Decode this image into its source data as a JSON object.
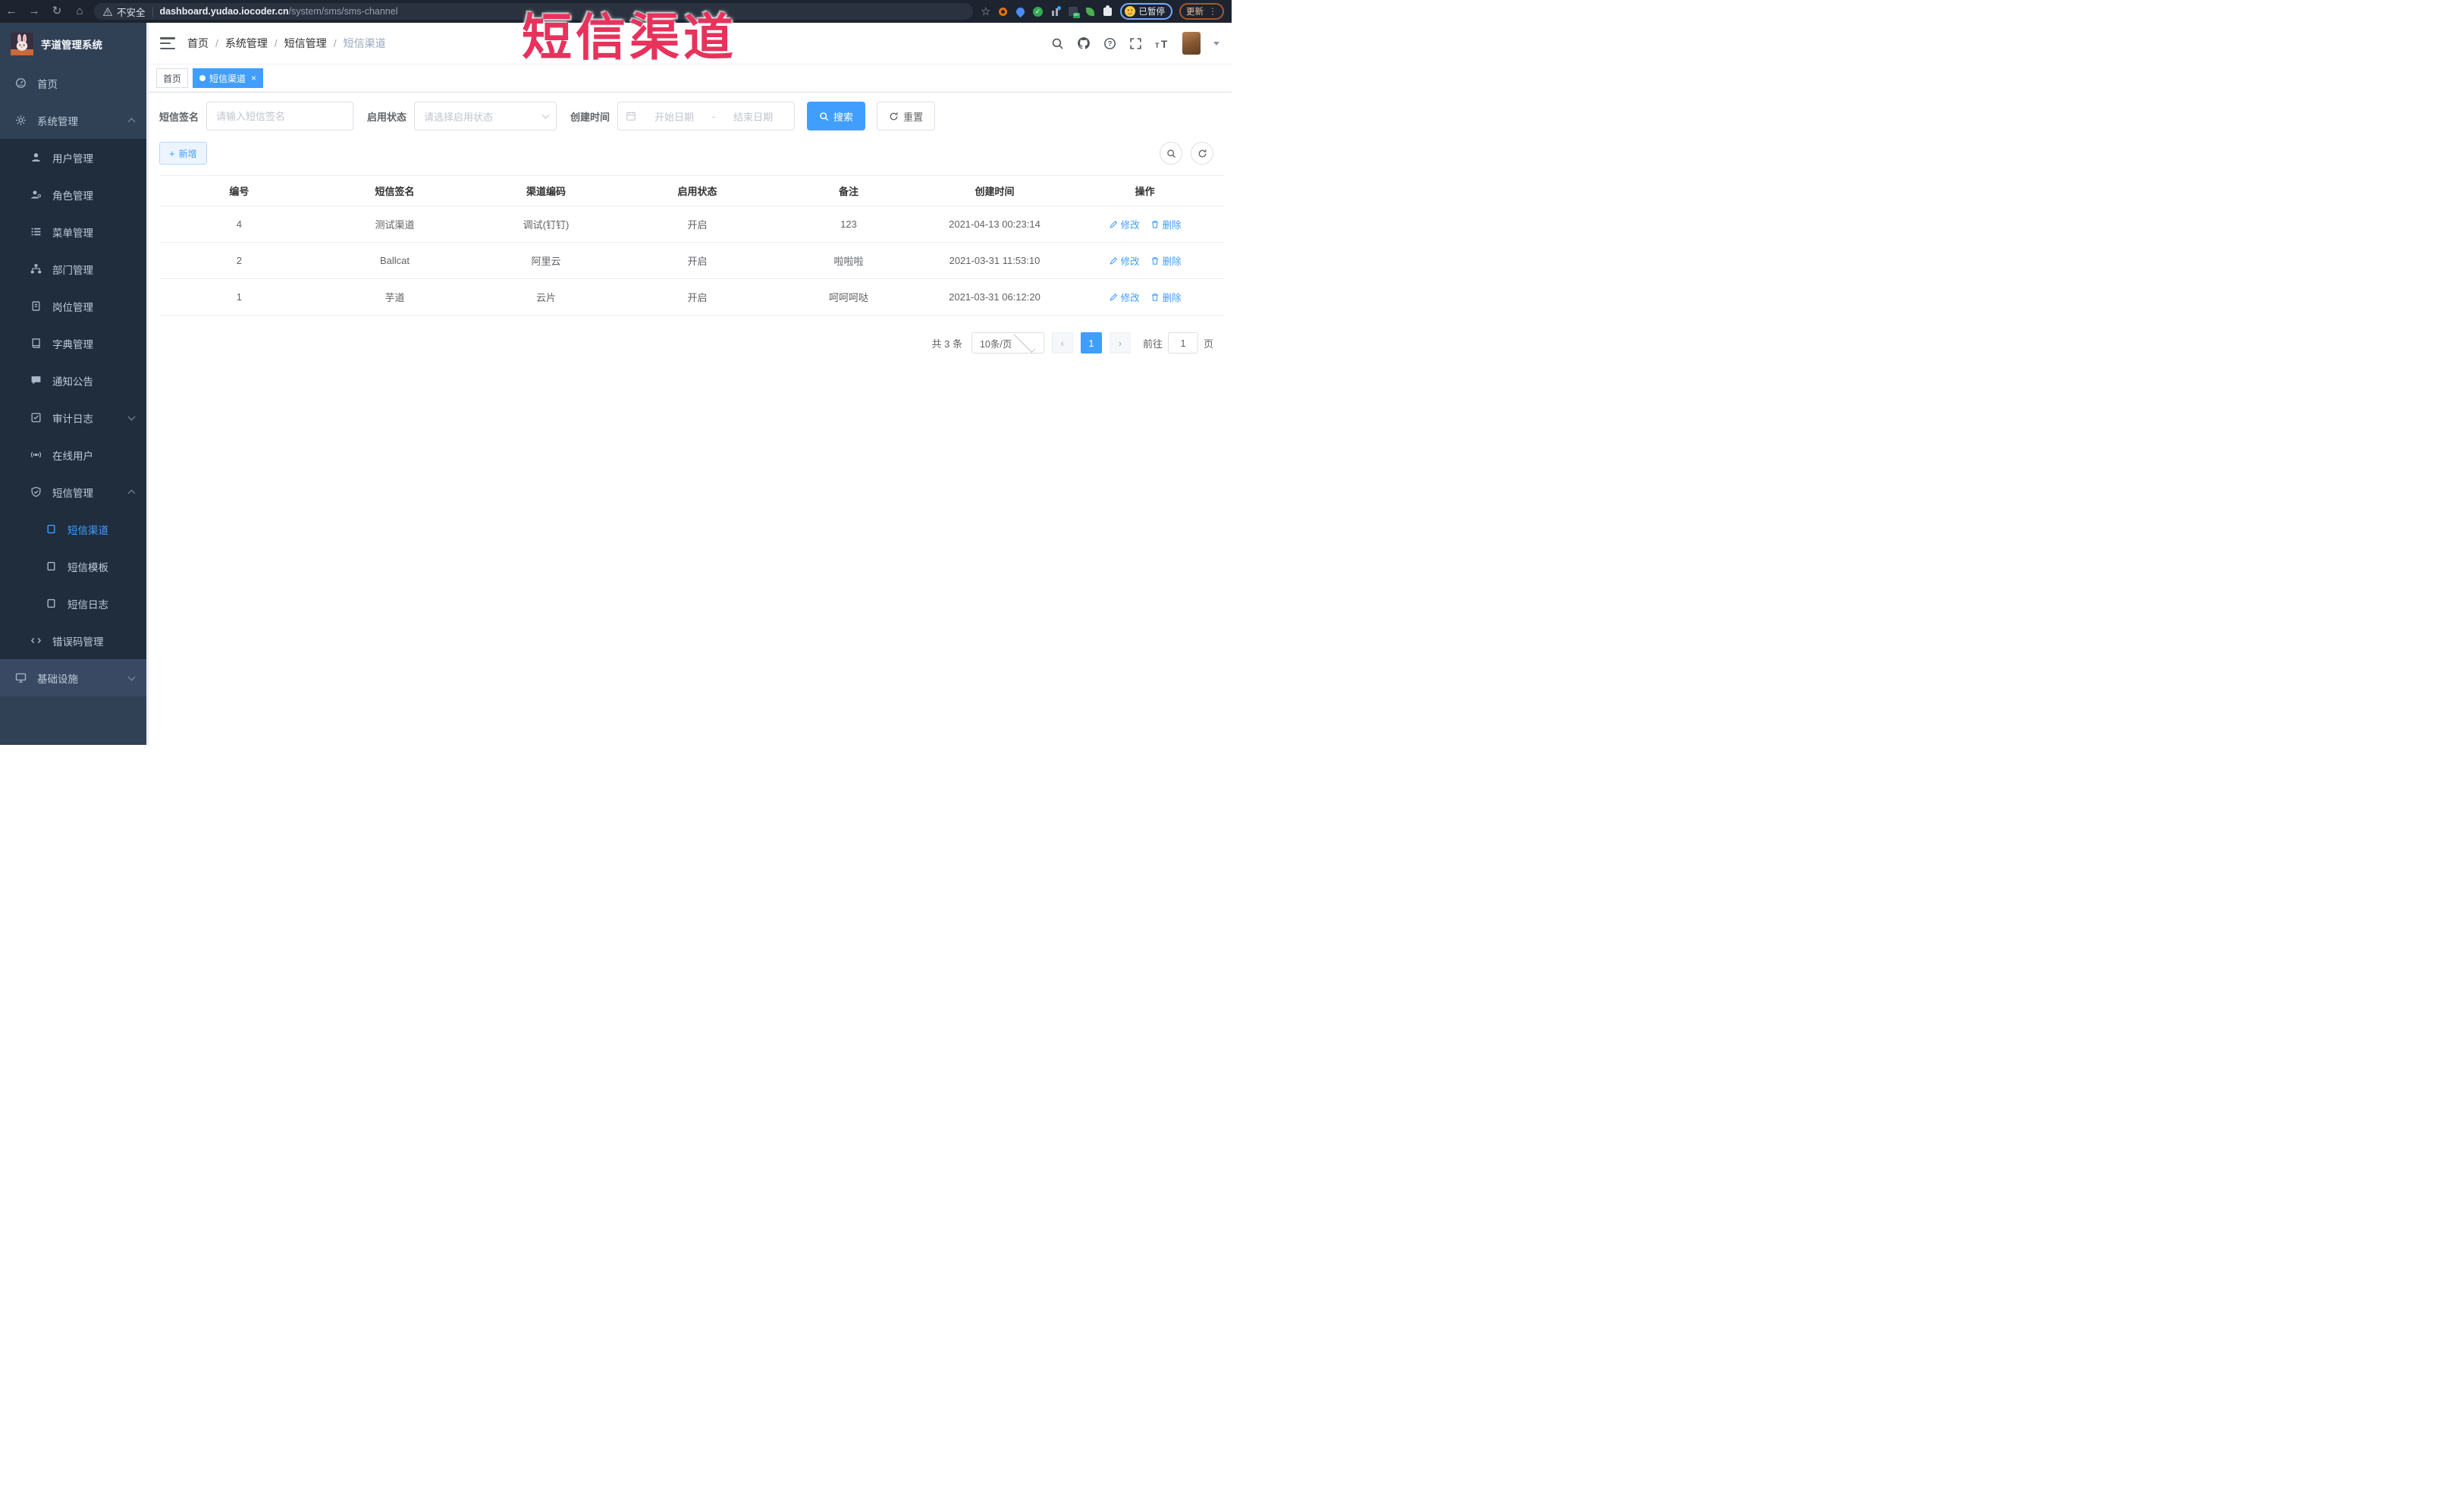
{
  "watermark": {
    "text": "短信渠道"
  },
  "browser": {
    "security_label": "不安全",
    "url_domain": "dashboard.yudao.iocoder.cn",
    "url_path": "/system/sms/sms-channel",
    "paused_label": "已暂停",
    "update_label": "更新"
  },
  "sidebar": {
    "app_title": "芋道管理系统",
    "items": [
      {
        "label": "首页"
      },
      {
        "label": "系统管理"
      },
      {
        "label": "用户管理"
      },
      {
        "label": "角色管理"
      },
      {
        "label": "菜单管理"
      },
      {
        "label": "部门管理"
      },
      {
        "label": "岗位管理"
      },
      {
        "label": "字典管理"
      },
      {
        "label": "通知公告"
      },
      {
        "label": "审计日志"
      },
      {
        "label": "在线用户"
      },
      {
        "label": "短信管理"
      },
      {
        "label": "短信渠道"
      },
      {
        "label": "短信模板"
      },
      {
        "label": "短信日志"
      },
      {
        "label": "错误码管理"
      },
      {
        "label": "基础设施"
      }
    ]
  },
  "header": {
    "breadcrumb": [
      "首页",
      "系统管理",
      "短信管理",
      "短信渠道"
    ]
  },
  "tabs": [
    {
      "label": "首页"
    },
    {
      "label": "短信渠道"
    }
  ],
  "filters": {
    "sign_label": "短信签名",
    "sign_placeholder": "请输入短信签名",
    "status_label": "启用状态",
    "status_placeholder": "请选择启用状态",
    "time_label": "创建时间",
    "start_placeholder": "开始日期",
    "range_separator": "-",
    "end_placeholder": "结束日期",
    "search_label": "搜索",
    "reset_label": "重置"
  },
  "toolbar": {
    "add_label": "新增"
  },
  "table": {
    "headers": [
      "编号",
      "短信签名",
      "渠道编码",
      "启用状态",
      "备注",
      "创建时间",
      "操作"
    ],
    "rows": [
      {
        "id": "4",
        "sign": "测试渠道",
        "code": "调试(钉钉)",
        "status": "开启",
        "remark": "123",
        "created": "2021-04-13 00:23:14"
      },
      {
        "id": "2",
        "sign": "Ballcat",
        "code": "阿里云",
        "status": "开启",
        "remark": "啦啦啦",
        "created": "2021-03-31 11:53:10"
      },
      {
        "id": "1",
        "sign": "芋道",
        "code": "云片",
        "status": "开启",
        "remark": "呵呵呵哒",
        "created": "2021-03-31 06:12:20"
      }
    ],
    "edit_label": "修改",
    "delete_label": "删除"
  },
  "pagination": {
    "total": "共 3 条",
    "page_size": "10条/页",
    "page": "1",
    "goto_label": "前往",
    "goto_value": "1",
    "unit_label": "页"
  },
  "colors": {
    "accent": "#409EFF",
    "sidebar_bg": "#304156",
    "submenu_bg": "#1f2d3d",
    "watermark": "#e7325c",
    "link": "#409EFF",
    "table_border": "#ebeef5"
  }
}
